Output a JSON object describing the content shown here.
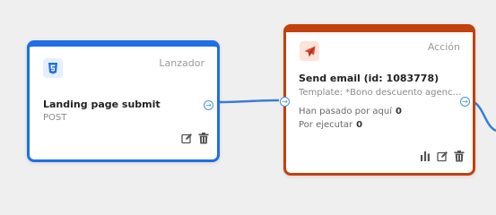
{
  "nodes": {
    "trigger": {
      "type_label": "Lanzador",
      "title": "Landing page submit",
      "method": "POST",
      "icon": "html5-icon",
      "accent": "#1f6fe5"
    },
    "action": {
      "type_label": "Acción",
      "title": "Send email (id: 1083778)",
      "template": "Template: *Bono descuento agencia...",
      "stat_passed_label": "Han pasado por aquí",
      "stat_passed_value": "0",
      "stat_pending_label": "Por ejecutar",
      "stat_pending_value": "0",
      "icon": "paper-plane-icon",
      "accent": "#c2410c"
    }
  },
  "colors": {
    "canvas": "#efefef",
    "edge": "#3d7bd8"
  }
}
